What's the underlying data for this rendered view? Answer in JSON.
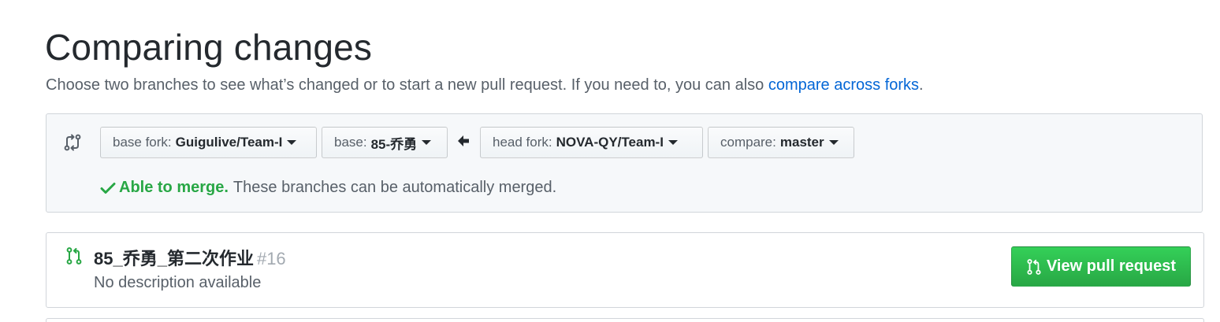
{
  "header": {
    "title": "Comparing changes",
    "subtitle_text": "Choose two branches to see what’s changed or to start a new pull request. If you need to, you can also ",
    "subtitle_link": "compare across forks",
    "subtitle_end": "."
  },
  "range": {
    "base_fork": {
      "label": "base fork:",
      "value": "Guigulive/Team-I"
    },
    "base": {
      "label": "base:",
      "value": "85-乔勇"
    },
    "head_fork": {
      "label": "head fork:",
      "value": "NOVA-QY/Team-I"
    },
    "compare": {
      "label": "compare:",
      "value": "master"
    },
    "merge_status_strong": "Able to merge.",
    "merge_status_text": "These branches can be automatically merged."
  },
  "pull_request": {
    "title": "85_乔勇_第二次作业",
    "number": "#16",
    "description": "No description available",
    "button_label": "View pull request"
  },
  "colors": {
    "link": "#0366d6",
    "success": "#28a745",
    "muted": "#586069"
  }
}
